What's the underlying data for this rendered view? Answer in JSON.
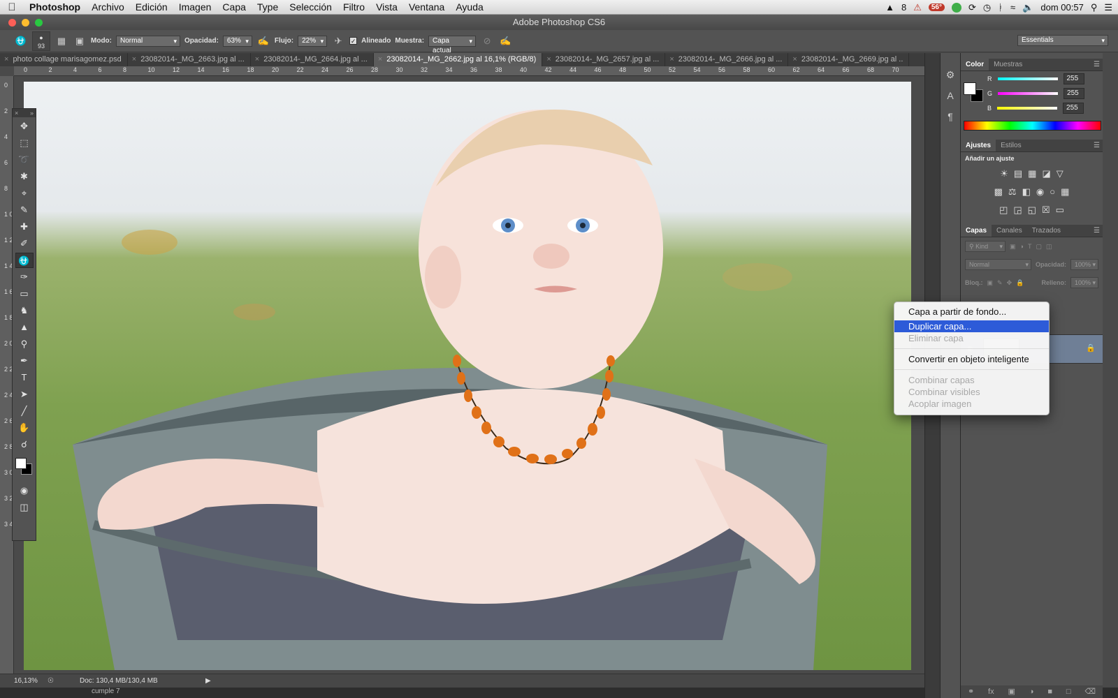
{
  "menubar": {
    "app": "Photoshop",
    "items": [
      "Archivo",
      "Edición",
      "Imagen",
      "Capa",
      "Type",
      "Selección",
      "Filtro",
      "Vista",
      "Ventana",
      "Ayuda"
    ],
    "status_count": "8",
    "temperature": "56°",
    "clock": "dom 00:57"
  },
  "window": {
    "title": "Adobe Photoshop CS6"
  },
  "options": {
    "brush_size": "93",
    "mode_label": "Modo:",
    "mode_value": "Normal",
    "opacity_label": "Opacidad:",
    "opacity_value": "63%",
    "flow_label": "Flujo:",
    "flow_value": "22%",
    "aligned_label": "Alineado",
    "sample_label": "Muestra:",
    "sample_value": "Capa actual",
    "workspace": "Essentials"
  },
  "tabs": [
    {
      "label": "photo collage marisagomez.psd"
    },
    {
      "label": "23082014-_MG_2663.jpg al ..."
    },
    {
      "label": "23082014-_MG_2664.jpg al ..."
    },
    {
      "label": "23082014-_MG_2662.jpg al 16,1% (RGB/8)"
    },
    {
      "label": "23082014-_MG_2657.jpg al ..."
    },
    {
      "label": "23082014-_MG_2666.jpg al ..."
    },
    {
      "label": "23082014-_MG_2669.jpg al .."
    }
  ],
  "ruler_h": [
    "0",
    "2",
    "4",
    "6",
    "8",
    "10",
    "12",
    "14",
    "16",
    "18",
    "20",
    "22",
    "24",
    "26",
    "28",
    "30",
    "32",
    "34",
    "36",
    "38",
    "40",
    "42",
    "44",
    "46",
    "48",
    "50",
    "52",
    "54",
    "56",
    "58",
    "60",
    "62",
    "64",
    "66",
    "68",
    "70"
  ],
  "ruler_v": [
    "0",
    "2",
    "4",
    "6",
    "8",
    "1 0",
    "1 2",
    "1 4",
    "1 6",
    "1 8",
    "2 0",
    "2 2",
    "2 4",
    "2 6",
    "2 8",
    "3 0",
    "3 2",
    "3 4"
  ],
  "status": {
    "zoom": "16,13%",
    "doc": "Doc: 130,4 MB/130,4 MB",
    "below_text": "cumple 7"
  },
  "color_panel": {
    "tabs": [
      "Color",
      "Muestras"
    ],
    "r_label": "R",
    "g_label": "G",
    "b_label": "B",
    "r": "255",
    "g": "255",
    "b": "255"
  },
  "adjust_panel": {
    "tabs": [
      "Ajustes",
      "Estilos"
    ],
    "title": "Añadir un ajuste"
  },
  "layers_panel": {
    "tabs": [
      "Capas",
      "Canales",
      "Trazados"
    ],
    "filter": "Kind",
    "blend": "Normal",
    "opacity_label": "Opacidad:",
    "opacity_value": "100%",
    "lock_label": "Bloq.:",
    "fill_label": "Relleno:",
    "fill_value": "100%"
  },
  "context_menu": {
    "items": [
      {
        "label": "Capa a partir de fondo...",
        "state": "normal"
      },
      {
        "label": "Duplicar capa...",
        "state": "selected"
      },
      {
        "label": "Eliminar capa",
        "state": "disabled"
      },
      {
        "label": "Convertir en objeto inteligente",
        "state": "normal"
      },
      {
        "label": "Combinar capas",
        "state": "disabled"
      },
      {
        "label": "Combinar visibles",
        "state": "disabled"
      },
      {
        "label": "Acoplar imagen",
        "state": "disabled"
      }
    ]
  },
  "colors": {
    "accent": "#2d5bd8",
    "panel_bg": "#535353",
    "layer_selected": "#6f7f96"
  }
}
